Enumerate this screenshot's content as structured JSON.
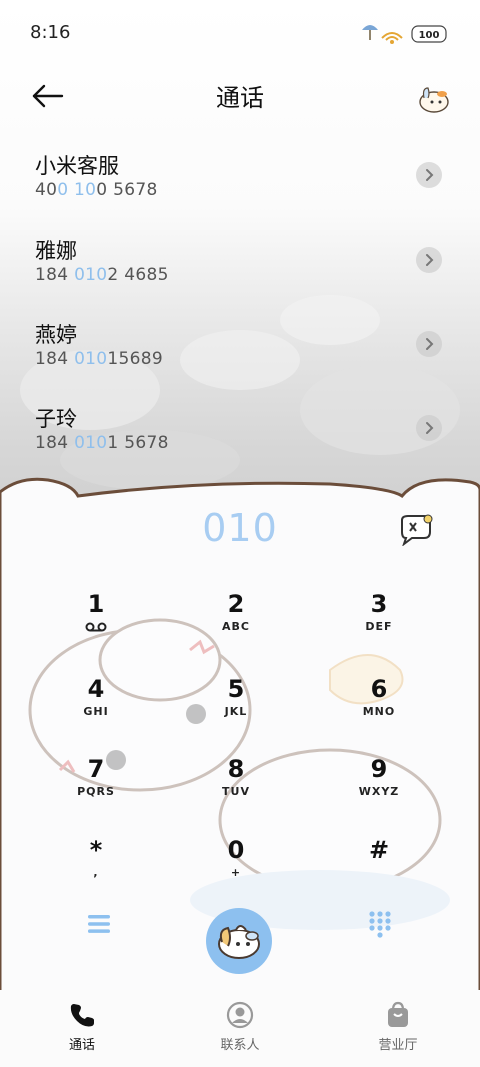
{
  "status_bar": {
    "time": "8:16",
    "battery": "100"
  },
  "header": {
    "title": "通话"
  },
  "contacts": [
    {
      "name": "小米客服",
      "number_parts": [
        "40",
        "0 10",
        "0 5678"
      ]
    },
    {
      "name": "雅娜",
      "number_parts": [
        "184 ",
        "010",
        "2 4685"
      ]
    },
    {
      "name": "燕婷",
      "number_parts": [
        "184 ",
        "010",
        "15689"
      ]
    },
    {
      "name": "子玲",
      "number_parts": [
        "184 ",
        "010",
        "1 5678"
      ]
    }
  ],
  "dialer": {
    "input": "010",
    "keys": [
      {
        "digit": "1",
        "letters": ""
      },
      {
        "digit": "2",
        "letters": "ABC"
      },
      {
        "digit": "3",
        "letters": "DEF"
      },
      {
        "digit": "4",
        "letters": "GHI"
      },
      {
        "digit": "5",
        "letters": "JKL"
      },
      {
        "digit": "6",
        "letters": "MNO"
      },
      {
        "digit": "7",
        "letters": "PQRS"
      },
      {
        "digit": "8",
        "letters": "TUV"
      },
      {
        "digit": "9",
        "letters": "WXYZ"
      },
      {
        "digit": "*",
        "letters": ","
      },
      {
        "digit": "0",
        "letters": "+"
      },
      {
        "digit": "#",
        "letters": ""
      }
    ]
  },
  "bottom_nav": [
    {
      "label": "通话",
      "active": true,
      "icon": "phone-icon"
    },
    {
      "label": "联系人",
      "active": false,
      "icon": "person-icon"
    },
    {
      "label": "营业厅",
      "active": false,
      "icon": "shopping-bag-icon"
    }
  ],
  "colors": {
    "accent": "#8dc0ef",
    "highlight": "#8fbfec",
    "dial_text": "#a8cdf2"
  }
}
